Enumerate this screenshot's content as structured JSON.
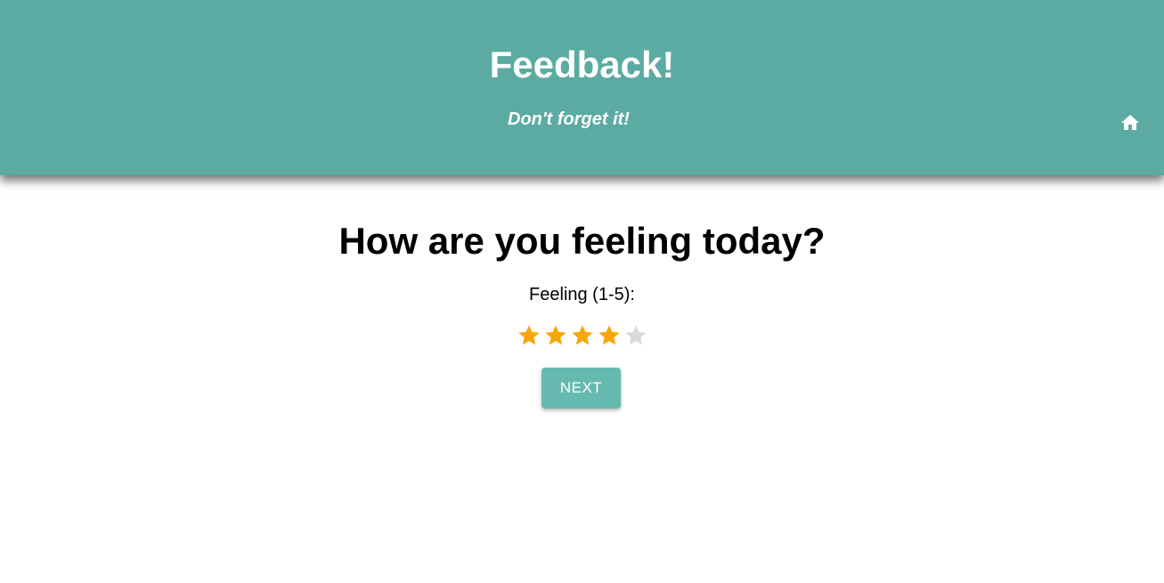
{
  "header": {
    "title": "Feedback!",
    "subtitle": "Don't forget it!",
    "home_icon": "home-icon",
    "background_color": "#5BABA2"
  },
  "main": {
    "question": "How are you feeling today?",
    "feeling_label": "Feeling (1-5):",
    "rating": {
      "value": 4,
      "max": 5,
      "filled_color": "#F5A70A",
      "empty_color": "#DADADA"
    },
    "next_button": {
      "label": "NEXT",
      "color": "#66B9AF"
    }
  }
}
